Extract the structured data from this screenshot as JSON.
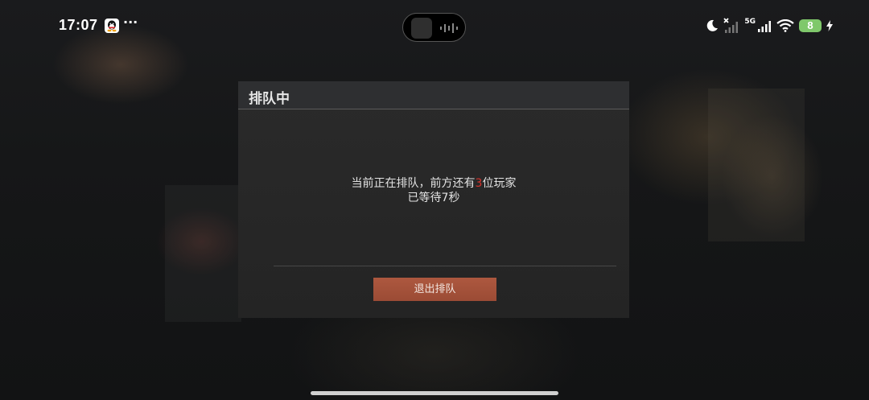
{
  "status_bar": {
    "time": "17:07",
    "more": "···",
    "network": "5G",
    "battery": "8"
  },
  "dialog": {
    "title": "排队中",
    "message_prefix": "当前正在排队，前方还有",
    "players_ahead": "3",
    "message_suffix": "位玩家",
    "wait_prefix": "已等待",
    "wait_seconds": "7",
    "wait_suffix": "秒",
    "quit_label": "退出排队"
  },
  "colors": {
    "accent_count": "#d8322c",
    "button": "#a5513b",
    "battery": "#7fc86b"
  },
  "icons": [
    "qq-icon",
    "do-not-disturb-icon",
    "cellular-no-signal-icon",
    "cellular-5g-signal-icon",
    "wifi-icon",
    "battery-icon",
    "charging-icon"
  ]
}
